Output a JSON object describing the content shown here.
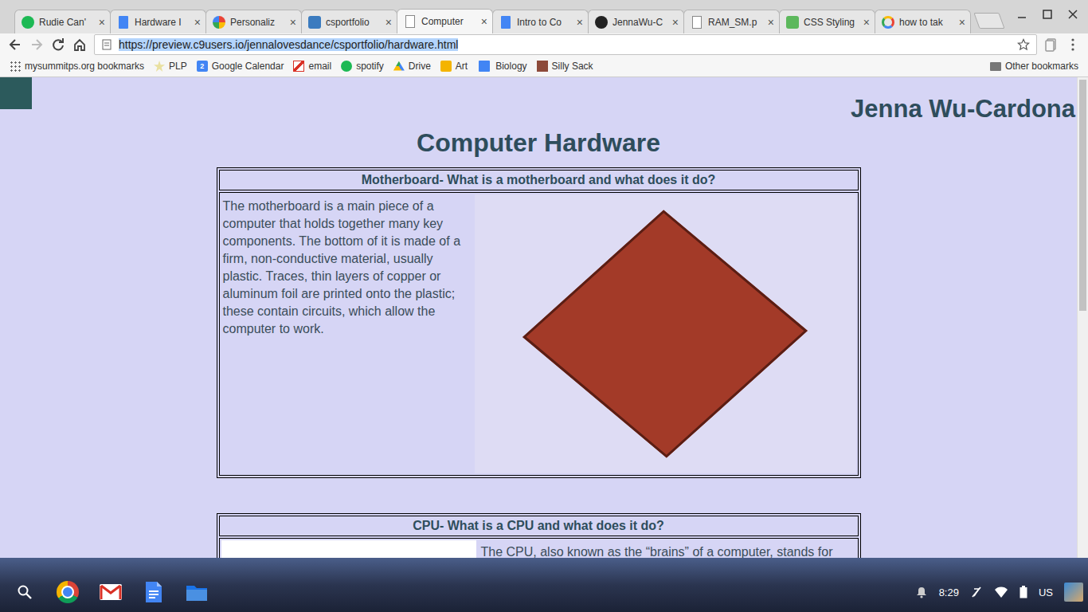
{
  "tabs": [
    {
      "label": "Rudie Can'",
      "kind": "spotify",
      "selected": false
    },
    {
      "label": "Hardware I",
      "kind": "docs",
      "selected": false
    },
    {
      "label": "Personaliz",
      "kind": "photos",
      "selected": false
    },
    {
      "label": "csportfolio",
      "kind": "preview",
      "selected": false
    },
    {
      "label": "Computer",
      "kind": "page",
      "selected": true
    },
    {
      "label": "Intro to Co",
      "kind": "docs",
      "selected": false
    },
    {
      "label": "JennaWu-C",
      "kind": "github",
      "selected": false
    },
    {
      "label": "RAM_SM.p",
      "kind": "page",
      "selected": false
    },
    {
      "label": "CSS Styling",
      "kind": "css",
      "selected": false
    },
    {
      "label": "how to tak",
      "kind": "google",
      "selected": false
    }
  ],
  "tab_close": "×",
  "address": {
    "url": "https://preview.c9users.io/jennalovesdance/csportfolio/hardware.html",
    "selected": true
  },
  "bookmarks": [
    {
      "label": "mysummitps.org bookmarks",
      "kind": "apps",
      "icon_text": ""
    },
    {
      "label": "PLP",
      "kind": "plp",
      "icon_text": ""
    },
    {
      "label": "Google Calendar",
      "kind": "calendar",
      "icon_text": "2"
    },
    {
      "label": "email",
      "kind": "gmail",
      "icon_text": ""
    },
    {
      "label": "spotify",
      "kind": "spotify",
      "icon_text": ""
    },
    {
      "label": "Drive",
      "kind": "drive",
      "icon_text": ""
    },
    {
      "label": "Art",
      "kind": "slides",
      "icon_text": ""
    },
    {
      "label": "Biology",
      "kind": "docs",
      "icon_text": ""
    },
    {
      "label": "Silly Sack",
      "kind": "silly",
      "icon_text": ""
    }
  ],
  "other_bookmarks": "Other bookmarks",
  "page": {
    "author": "Jenna Wu-Cardona",
    "title": "Computer Hardware",
    "sections": [
      {
        "heading": "Motherboard- What is a motherboard and what does it do?",
        "kind": "image-right",
        "text": "The motherboard is a main piece of a computer that holds together many key components. The bottom of it is made of a firm, non-conductive material, usually plastic. Traces, thin layers of copper or aluminum foil are printed onto the plastic; these contain circuits, which allow the computer to work."
      },
      {
        "heading": "CPU- What is a CPU and what does it do?",
        "kind": "image-left",
        "text": "The CPU, also known as the “brains” of a computer, stands for"
      }
    ]
  },
  "shelf": {
    "apps": [
      {
        "kind": "launcher"
      },
      {
        "kind": "chrome"
      },
      {
        "kind": "gmail"
      },
      {
        "kind": "docs"
      },
      {
        "kind": "files"
      }
    ],
    "time": "8:29",
    "ime": "US"
  }
}
